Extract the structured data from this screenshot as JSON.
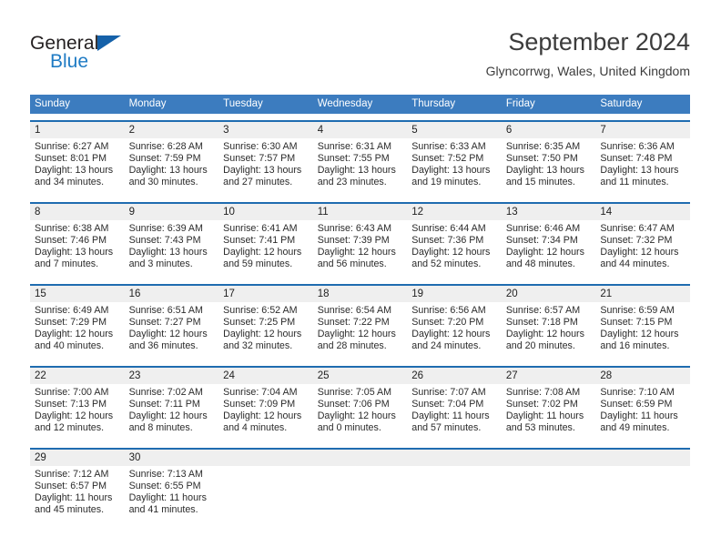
{
  "brand": {
    "name_top": "General",
    "name_bottom": "Blue",
    "accent_color": "#1f7bc4",
    "triangle_color": "#1561a9"
  },
  "header": {
    "title": "September 2024",
    "location": "Glyncorrwg, Wales, United Kingdom"
  },
  "theme": {
    "header_blue": "#3c7cbf",
    "week_rule_blue": "#1f6cb0",
    "day_band_gray": "#efefef"
  },
  "weekdays": [
    "Sunday",
    "Monday",
    "Tuesday",
    "Wednesday",
    "Thursday",
    "Friday",
    "Saturday"
  ],
  "weeks": [
    [
      {
        "day": "1",
        "sunrise": "Sunrise: 6:27 AM",
        "sunset": "Sunset: 8:01 PM",
        "daylight": "Daylight: 13 hours and 34 minutes."
      },
      {
        "day": "2",
        "sunrise": "Sunrise: 6:28 AM",
        "sunset": "Sunset: 7:59 PM",
        "daylight": "Daylight: 13 hours and 30 minutes."
      },
      {
        "day": "3",
        "sunrise": "Sunrise: 6:30 AM",
        "sunset": "Sunset: 7:57 PM",
        "daylight": "Daylight: 13 hours and 27 minutes."
      },
      {
        "day": "4",
        "sunrise": "Sunrise: 6:31 AM",
        "sunset": "Sunset: 7:55 PM",
        "daylight": "Daylight: 13 hours and 23 minutes."
      },
      {
        "day": "5",
        "sunrise": "Sunrise: 6:33 AM",
        "sunset": "Sunset: 7:52 PM",
        "daylight": "Daylight: 13 hours and 19 minutes."
      },
      {
        "day": "6",
        "sunrise": "Sunrise: 6:35 AM",
        "sunset": "Sunset: 7:50 PM",
        "daylight": "Daylight: 13 hours and 15 minutes."
      },
      {
        "day": "7",
        "sunrise": "Sunrise: 6:36 AM",
        "sunset": "Sunset: 7:48 PM",
        "daylight": "Daylight: 13 hours and 11 minutes."
      }
    ],
    [
      {
        "day": "8",
        "sunrise": "Sunrise: 6:38 AM",
        "sunset": "Sunset: 7:46 PM",
        "daylight": "Daylight: 13 hours and 7 minutes."
      },
      {
        "day": "9",
        "sunrise": "Sunrise: 6:39 AM",
        "sunset": "Sunset: 7:43 PM",
        "daylight": "Daylight: 13 hours and 3 minutes."
      },
      {
        "day": "10",
        "sunrise": "Sunrise: 6:41 AM",
        "sunset": "Sunset: 7:41 PM",
        "daylight": "Daylight: 12 hours and 59 minutes."
      },
      {
        "day": "11",
        "sunrise": "Sunrise: 6:43 AM",
        "sunset": "Sunset: 7:39 PM",
        "daylight": "Daylight: 12 hours and 56 minutes."
      },
      {
        "day": "12",
        "sunrise": "Sunrise: 6:44 AM",
        "sunset": "Sunset: 7:36 PM",
        "daylight": "Daylight: 12 hours and 52 minutes."
      },
      {
        "day": "13",
        "sunrise": "Sunrise: 6:46 AM",
        "sunset": "Sunset: 7:34 PM",
        "daylight": "Daylight: 12 hours and 48 minutes."
      },
      {
        "day": "14",
        "sunrise": "Sunrise: 6:47 AM",
        "sunset": "Sunset: 7:32 PM",
        "daylight": "Daylight: 12 hours and 44 minutes."
      }
    ],
    [
      {
        "day": "15",
        "sunrise": "Sunrise: 6:49 AM",
        "sunset": "Sunset: 7:29 PM",
        "daylight": "Daylight: 12 hours and 40 minutes."
      },
      {
        "day": "16",
        "sunrise": "Sunrise: 6:51 AM",
        "sunset": "Sunset: 7:27 PM",
        "daylight": "Daylight: 12 hours and 36 minutes."
      },
      {
        "day": "17",
        "sunrise": "Sunrise: 6:52 AM",
        "sunset": "Sunset: 7:25 PM",
        "daylight": "Daylight: 12 hours and 32 minutes."
      },
      {
        "day": "18",
        "sunrise": "Sunrise: 6:54 AM",
        "sunset": "Sunset: 7:22 PM",
        "daylight": "Daylight: 12 hours and 28 minutes."
      },
      {
        "day": "19",
        "sunrise": "Sunrise: 6:56 AM",
        "sunset": "Sunset: 7:20 PM",
        "daylight": "Daylight: 12 hours and 24 minutes."
      },
      {
        "day": "20",
        "sunrise": "Sunrise: 6:57 AM",
        "sunset": "Sunset: 7:18 PM",
        "daylight": "Daylight: 12 hours and 20 minutes."
      },
      {
        "day": "21",
        "sunrise": "Sunrise: 6:59 AM",
        "sunset": "Sunset: 7:15 PM",
        "daylight": "Daylight: 12 hours and 16 minutes."
      }
    ],
    [
      {
        "day": "22",
        "sunrise": "Sunrise: 7:00 AM",
        "sunset": "Sunset: 7:13 PM",
        "daylight": "Daylight: 12 hours and 12 minutes."
      },
      {
        "day": "23",
        "sunrise": "Sunrise: 7:02 AM",
        "sunset": "Sunset: 7:11 PM",
        "daylight": "Daylight: 12 hours and 8 minutes."
      },
      {
        "day": "24",
        "sunrise": "Sunrise: 7:04 AM",
        "sunset": "Sunset: 7:09 PM",
        "daylight": "Daylight: 12 hours and 4 minutes."
      },
      {
        "day": "25",
        "sunrise": "Sunrise: 7:05 AM",
        "sunset": "Sunset: 7:06 PM",
        "daylight": "Daylight: 12 hours and 0 minutes."
      },
      {
        "day": "26",
        "sunrise": "Sunrise: 7:07 AM",
        "sunset": "Sunset: 7:04 PM",
        "daylight": "Daylight: 11 hours and 57 minutes."
      },
      {
        "day": "27",
        "sunrise": "Sunrise: 7:08 AM",
        "sunset": "Sunset: 7:02 PM",
        "daylight": "Daylight: 11 hours and 53 minutes."
      },
      {
        "day": "28",
        "sunrise": "Sunrise: 7:10 AM",
        "sunset": "Sunset: 6:59 PM",
        "daylight": "Daylight: 11 hours and 49 minutes."
      }
    ],
    [
      {
        "day": "29",
        "sunrise": "Sunrise: 7:12 AM",
        "sunset": "Sunset: 6:57 PM",
        "daylight": "Daylight: 11 hours and 45 minutes."
      },
      {
        "day": "30",
        "sunrise": "Sunrise: 7:13 AM",
        "sunset": "Sunset: 6:55 PM",
        "daylight": "Daylight: 11 hours and 41 minutes."
      },
      {
        "day": "",
        "sunrise": "",
        "sunset": "",
        "daylight": ""
      },
      {
        "day": "",
        "sunrise": "",
        "sunset": "",
        "daylight": ""
      },
      {
        "day": "",
        "sunrise": "",
        "sunset": "",
        "daylight": ""
      },
      {
        "day": "",
        "sunrise": "",
        "sunset": "",
        "daylight": ""
      },
      {
        "day": "",
        "sunrise": "",
        "sunset": "",
        "daylight": ""
      }
    ]
  ]
}
